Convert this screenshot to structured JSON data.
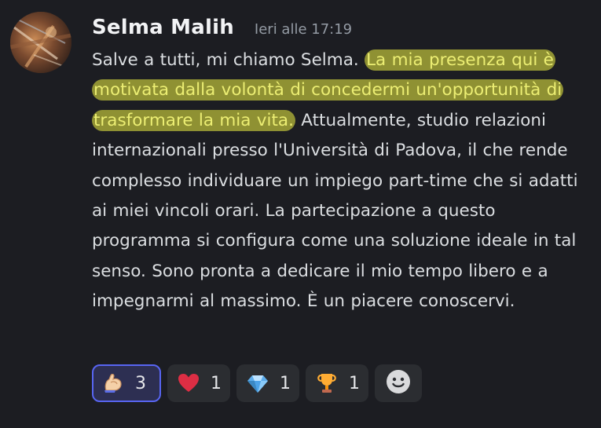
{
  "message": {
    "author": "Selma Malih",
    "timestamp": "Ieri alle 17:19",
    "text_before": "Salve a tutti, mi chiamo Selma. ",
    "text_highlighted": "La mia presenza qui è motivata dalla volontà di concedermi un'opportunità di trasformare la mia vita.",
    "text_after": " Attualmente, studio relazioni internazionali presso l'Università di Padova, il che rende complesso individuare un impiego part-time che si adatti ai miei vincoli orari. La partecipazione a questo programma si configura come una soluzione ideale in tal senso. Sono pronta a dedicare il mio tempo libero e a impegnarmi al massimo. È un piacere conoscervi."
  },
  "reactions": [
    {
      "emoji": "flexed-biceps-icon",
      "count": "3",
      "active": true
    },
    {
      "emoji": "red-heart-icon",
      "count": "1",
      "active": false
    },
    {
      "emoji": "gem-stone-icon",
      "count": "1",
      "active": false
    },
    {
      "emoji": "trophy-icon",
      "count": "1",
      "active": false
    }
  ],
  "add_reaction_icon": "add-reaction-smiley-icon",
  "colors": {
    "background": "#1c1d22",
    "text": "#dbdee1",
    "highlight": "#d6d83e",
    "active_reaction_border": "#5865f2"
  }
}
